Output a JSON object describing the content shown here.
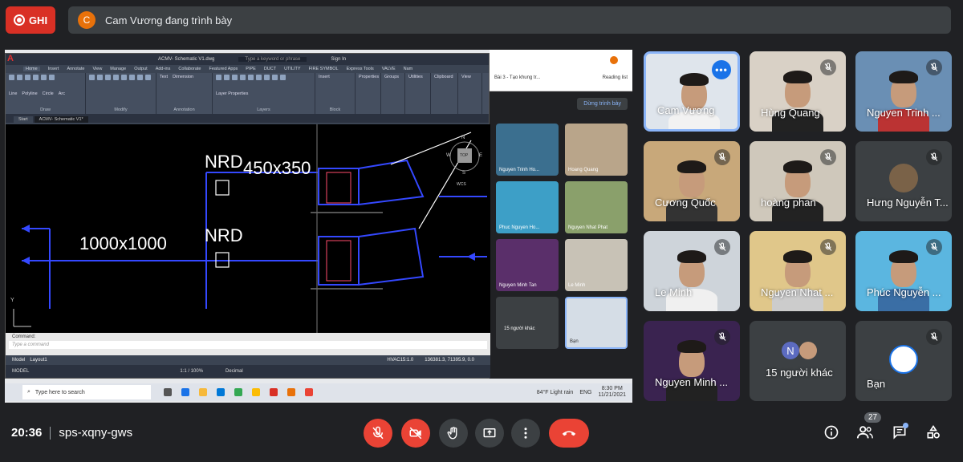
{
  "recording": {
    "label": "GHI",
    "color": "#d93025"
  },
  "presenter_banner": {
    "avatar_letter": "C",
    "text": "Cam Vương đang trình bày"
  },
  "shared_screen": {
    "autocad": {
      "title": "ACMV- Schematic V1.dwg",
      "search_placeholder": "Type a keyword or phrase",
      "sign_in": "Sign In",
      "ribbon_tabs": [
        "Home",
        "Insert",
        "Annotate",
        "View",
        "Manage",
        "Output",
        "Add-ins",
        "Collaborate",
        "Featured Apps",
        "PIPE",
        "DUCT",
        "UTILITY",
        "FIRE SYMBOL",
        "Express Tools",
        "VALVE",
        "Nam"
      ],
      "tool_labels": [
        "Line",
        "Polyline",
        "Circle",
        "Arc",
        "Text",
        "Dimension",
        "Layer Properties",
        "Insert",
        "Properties",
        "Groups",
        "Utilities",
        "Clipboard",
        "View"
      ],
      "ribbon_groups": [
        "Draw",
        "Modify",
        "Annotation",
        "Layers",
        "Block"
      ],
      "doc_tabs": [
        "Start",
        "ACMV- Schematic V1*"
      ],
      "drawing_labels": {
        "nrd_top": "NRD",
        "size_top": "450x350",
        "nrd_bottom": "NRD",
        "size_bottom": "1000x1000"
      },
      "viewcube": {
        "n": "N",
        "w": "W",
        "e": "E",
        "s": "S",
        "top": "TOP",
        "wcs": "WCS"
      },
      "axis_y": "Y",
      "command_label": "Command:",
      "command_placeholder": "Type a command",
      "layout_tabs": [
        "Model",
        "Layout1"
      ],
      "coords": "HVAC15:1.0",
      "coord_readout": "136381.3, 71395.9, 0.0",
      "status_items": [
        "MODEL",
        "1:1 / 100%",
        "Decimal"
      ]
    },
    "browser": {
      "tab_text": "Bài 3 - Tạo khung tr...",
      "reading_list": "Reading list",
      "avatar_letter": "C"
    },
    "mini_meet": {
      "stop_presenting": "Dừng trình bày",
      "tiles": [
        {
          "name": "Nguyen Trinh Ho..."
        },
        {
          "name": "Hoang Quang"
        },
        {
          "name": "Phuc Nguyen Ho..."
        },
        {
          "name": "Nguyen Nhat Phat"
        },
        {
          "name": "Nguyen Minh Tan"
        },
        {
          "name": "Le Minh"
        },
        {
          "name": "15 người khác"
        },
        {
          "name": "Bạn"
        }
      ],
      "participant_count": "27"
    },
    "taskbar": {
      "search_placeholder": "Type here to search",
      "weather": "84°F Light rain",
      "lang": "ENG",
      "time": "8:30 PM",
      "date": "11/21/2021"
    }
  },
  "participants": [
    {
      "name": "Cam Vương",
      "muted": false,
      "speaking": true
    },
    {
      "name": "Hùng Quang",
      "muted": true
    },
    {
      "name": "Nguyen Trinh ...",
      "muted": true
    },
    {
      "name": "Cương Quốc",
      "muted": true
    },
    {
      "name": "hoàng phan",
      "muted": true
    },
    {
      "name": "Hưng Nguyễn T...",
      "muted": true
    },
    {
      "name": "Le Minh",
      "muted": true
    },
    {
      "name": "Nguyen Nhat ...",
      "muted": true
    },
    {
      "name": "Phúc Nguyễn ...",
      "muted": true
    },
    {
      "name": "Nguyen Minh ...",
      "muted": true
    },
    {
      "name": "15 người khác",
      "avatar_letter": "N"
    },
    {
      "name": "Bạn",
      "muted": true
    }
  ],
  "bottom_bar": {
    "time": "20:36",
    "meeting_code": "sps-xqny-gws",
    "participant_count": "27",
    "colors": {
      "danger": "#ea4335",
      "control_gray": "#3c4043",
      "accent": "#8ab4f8"
    }
  }
}
